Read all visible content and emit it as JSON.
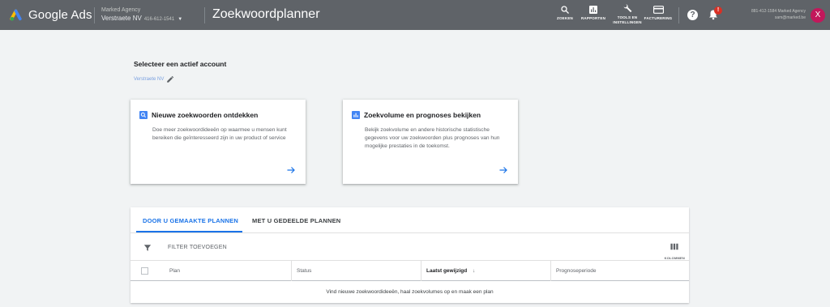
{
  "header": {
    "brand": "Google Ads",
    "account_agency": "Marked Agency",
    "account_name": "Verstraete NV",
    "account_id": "416-612-1541",
    "page_title": "Zoekwoordplanner",
    "tools": [
      {
        "label": "ZOEKEN",
        "icon": "search-icon"
      },
      {
        "label": "RAPPORTEN",
        "icon": "reports-icon"
      },
      {
        "label": "TOOLS EN INSTELLINGEN",
        "icon": "wrench-icon"
      },
      {
        "label": "FACTURERING",
        "icon": "billing-card-icon"
      }
    ],
    "help_glyph": "?",
    "notification_count": "!",
    "user_line1": "881-412-1584 Marked Agency",
    "user_line2": "sam@marked.be",
    "avatar_letter": "X"
  },
  "main": {
    "select_title": "Selecteer een actief account",
    "selected_account": "Verstraete NV"
  },
  "cards": [
    {
      "title": "Nieuwe zoekwoorden ontdekken",
      "description": "Doe meer zoekwoordideeën op waarmee u mensen kunt bereiken die geïnteresseerd zijn in uw product of service",
      "icon": "search-icon"
    },
    {
      "title": "Zoekvolume en prognoses bekijken",
      "description": "Bekijk zoekvolume en andere historische statistische gegevens voor uw zoekwoorden plus prognoses van hun mogelijke prestaties in de toekomst.",
      "icon": "bar-chart-icon"
    }
  ],
  "plans": {
    "tabs": [
      "DOOR U GEMAAKTE PLANNEN",
      "MET U GEDEELDE PLANNEN"
    ],
    "active_tab": 0,
    "filter_label": "FILTER TOEVOEGEN",
    "columns_label": "KOLOMMEN",
    "table_headers": [
      "Plan",
      "Status",
      "Laatst gewijzigd",
      "Prognoseperiode"
    ],
    "sort_indicator": "↓",
    "empty_message": "Vind nieuwe zoekwoordideeën, haal zoekvolumes op en maak een plan"
  },
  "colors": {
    "topbar": "#5f6368",
    "accent": "#1a73e8",
    "avatar": "#c2185b",
    "badge": "#d93025"
  }
}
